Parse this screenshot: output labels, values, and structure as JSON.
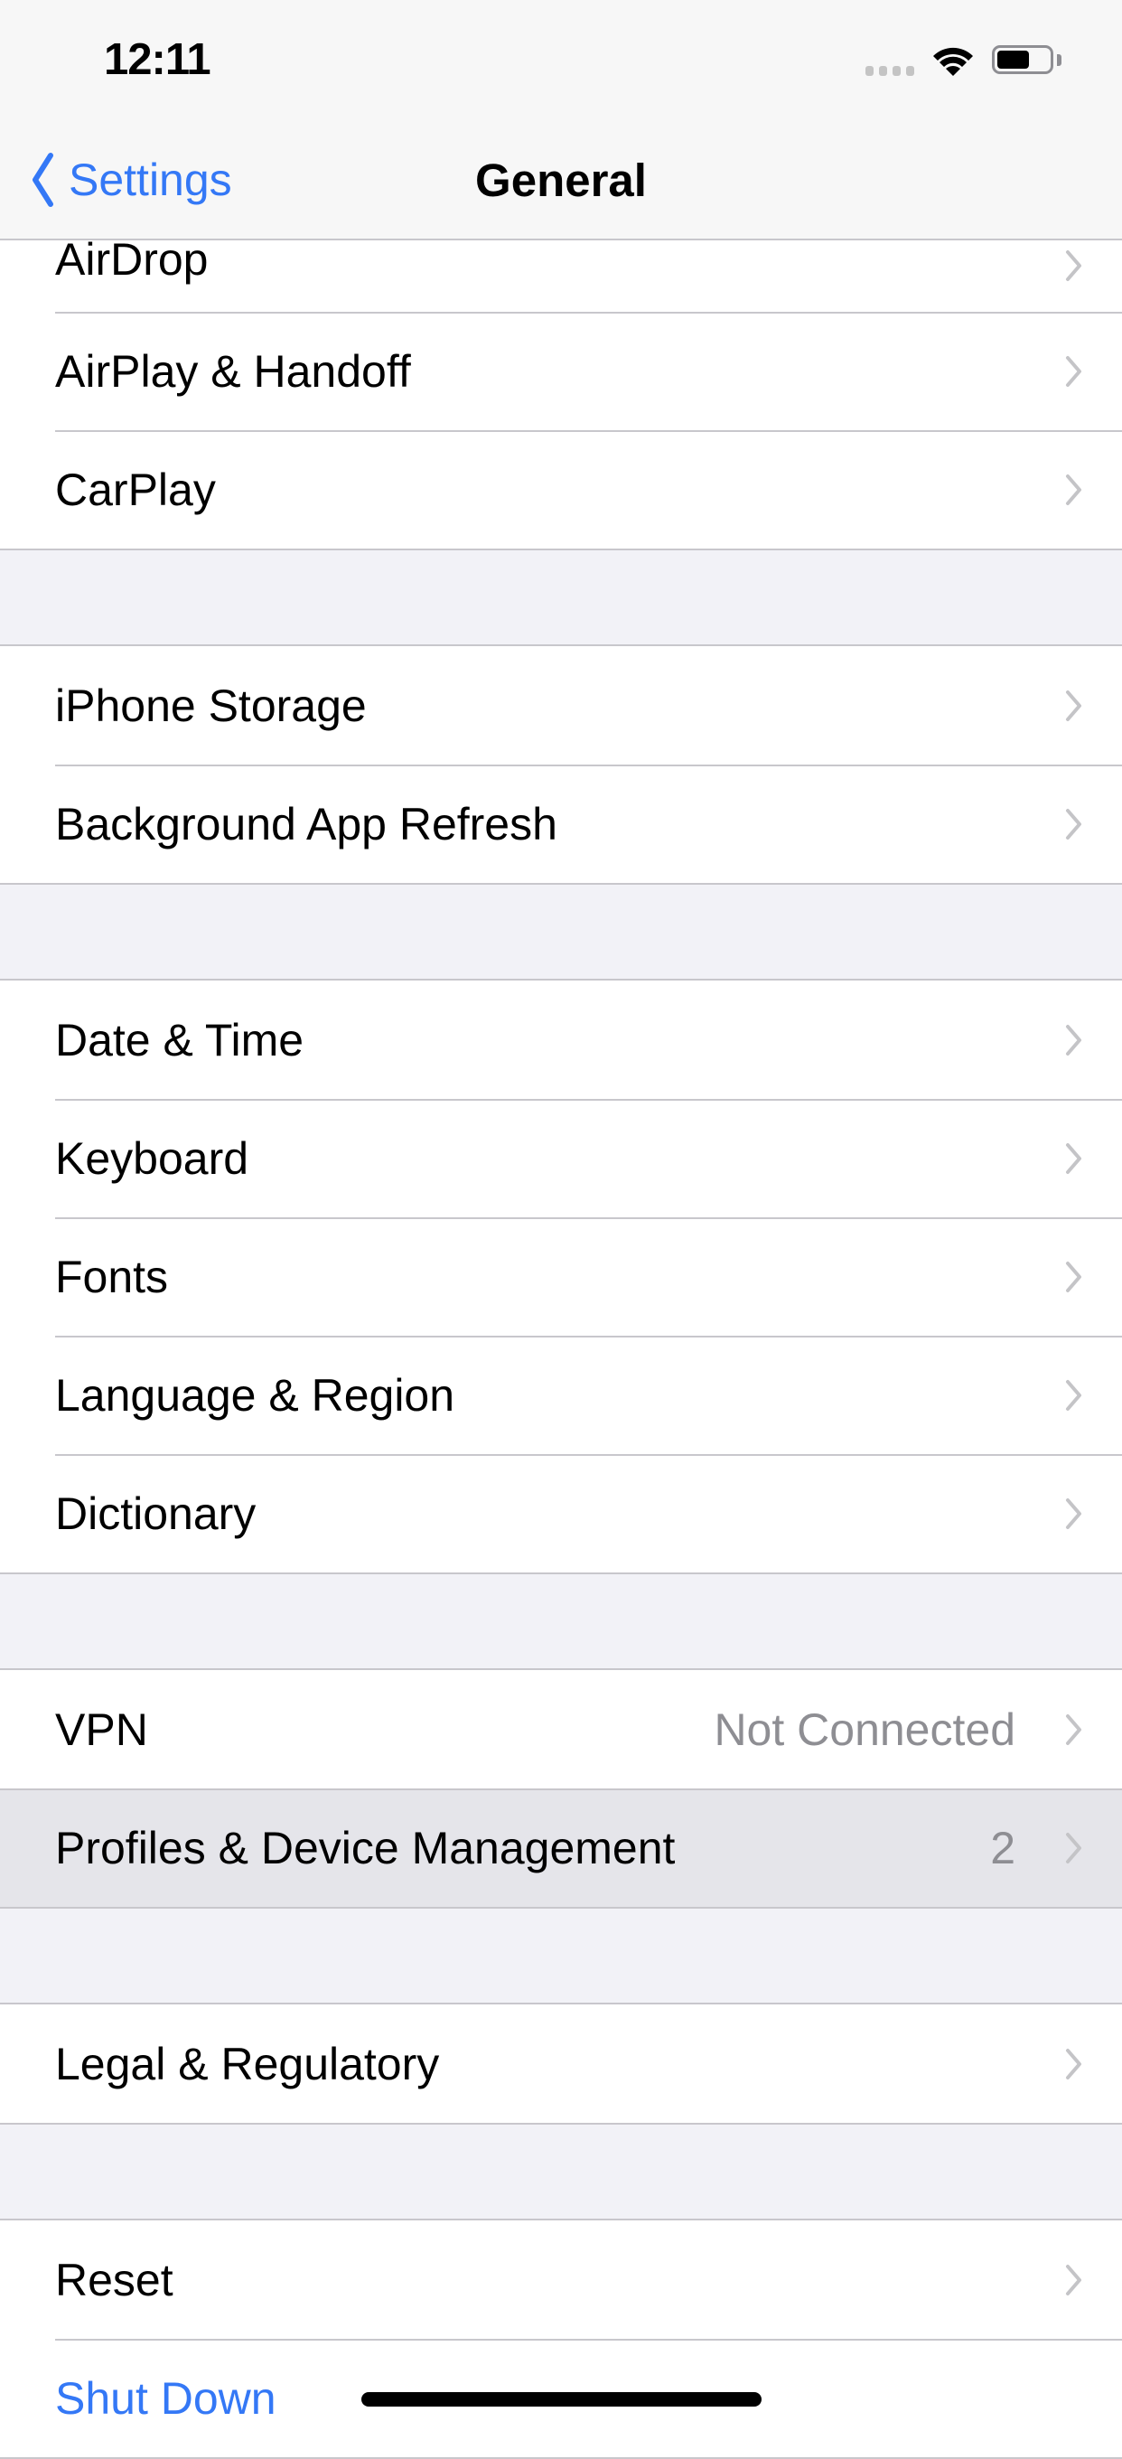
{
  "status_bar": {
    "time": "12:11",
    "battery_percent": 63,
    "signal_icon": "cellular-signal-icon",
    "wifi_icon": "wifi-icon",
    "battery_icon": "battery-icon"
  },
  "nav": {
    "back_label": "Settings",
    "back_icon": "chevron-left-icon",
    "title": "General"
  },
  "colors": {
    "accent": "#3478F6",
    "background": "#F2F2F7",
    "separator": "#C8C7CC",
    "secondary_text": "#8E8E93",
    "selected_row": "#E5E5EA"
  },
  "groups": [
    {
      "rows": [
        {
          "label": "AirDrop",
          "chevron": true
        },
        {
          "label": "AirPlay & Handoff",
          "chevron": true
        },
        {
          "label": "CarPlay",
          "chevron": true
        }
      ]
    },
    {
      "rows": [
        {
          "label": "iPhone Storage",
          "chevron": true
        },
        {
          "label": "Background App Refresh",
          "chevron": true
        }
      ]
    },
    {
      "rows": [
        {
          "label": "Date & Time",
          "chevron": true
        },
        {
          "label": "Keyboard",
          "chevron": true
        },
        {
          "label": "Fonts",
          "chevron": true
        },
        {
          "label": "Language & Region",
          "chevron": true
        },
        {
          "label": "Dictionary",
          "chevron": true
        }
      ]
    },
    {
      "rows": [
        {
          "label": "VPN",
          "value": "Not Connected",
          "chevron": true
        },
        {
          "label": "Profiles & Device Management",
          "value": "2",
          "chevron": true,
          "selected": true
        }
      ]
    },
    {
      "rows": [
        {
          "label": "Legal & Regulatory",
          "chevron": true
        }
      ]
    },
    {
      "rows": [
        {
          "label": "Reset",
          "chevron": true
        },
        {
          "label": "Shut Down",
          "chevron": false,
          "link": true
        }
      ]
    }
  ]
}
